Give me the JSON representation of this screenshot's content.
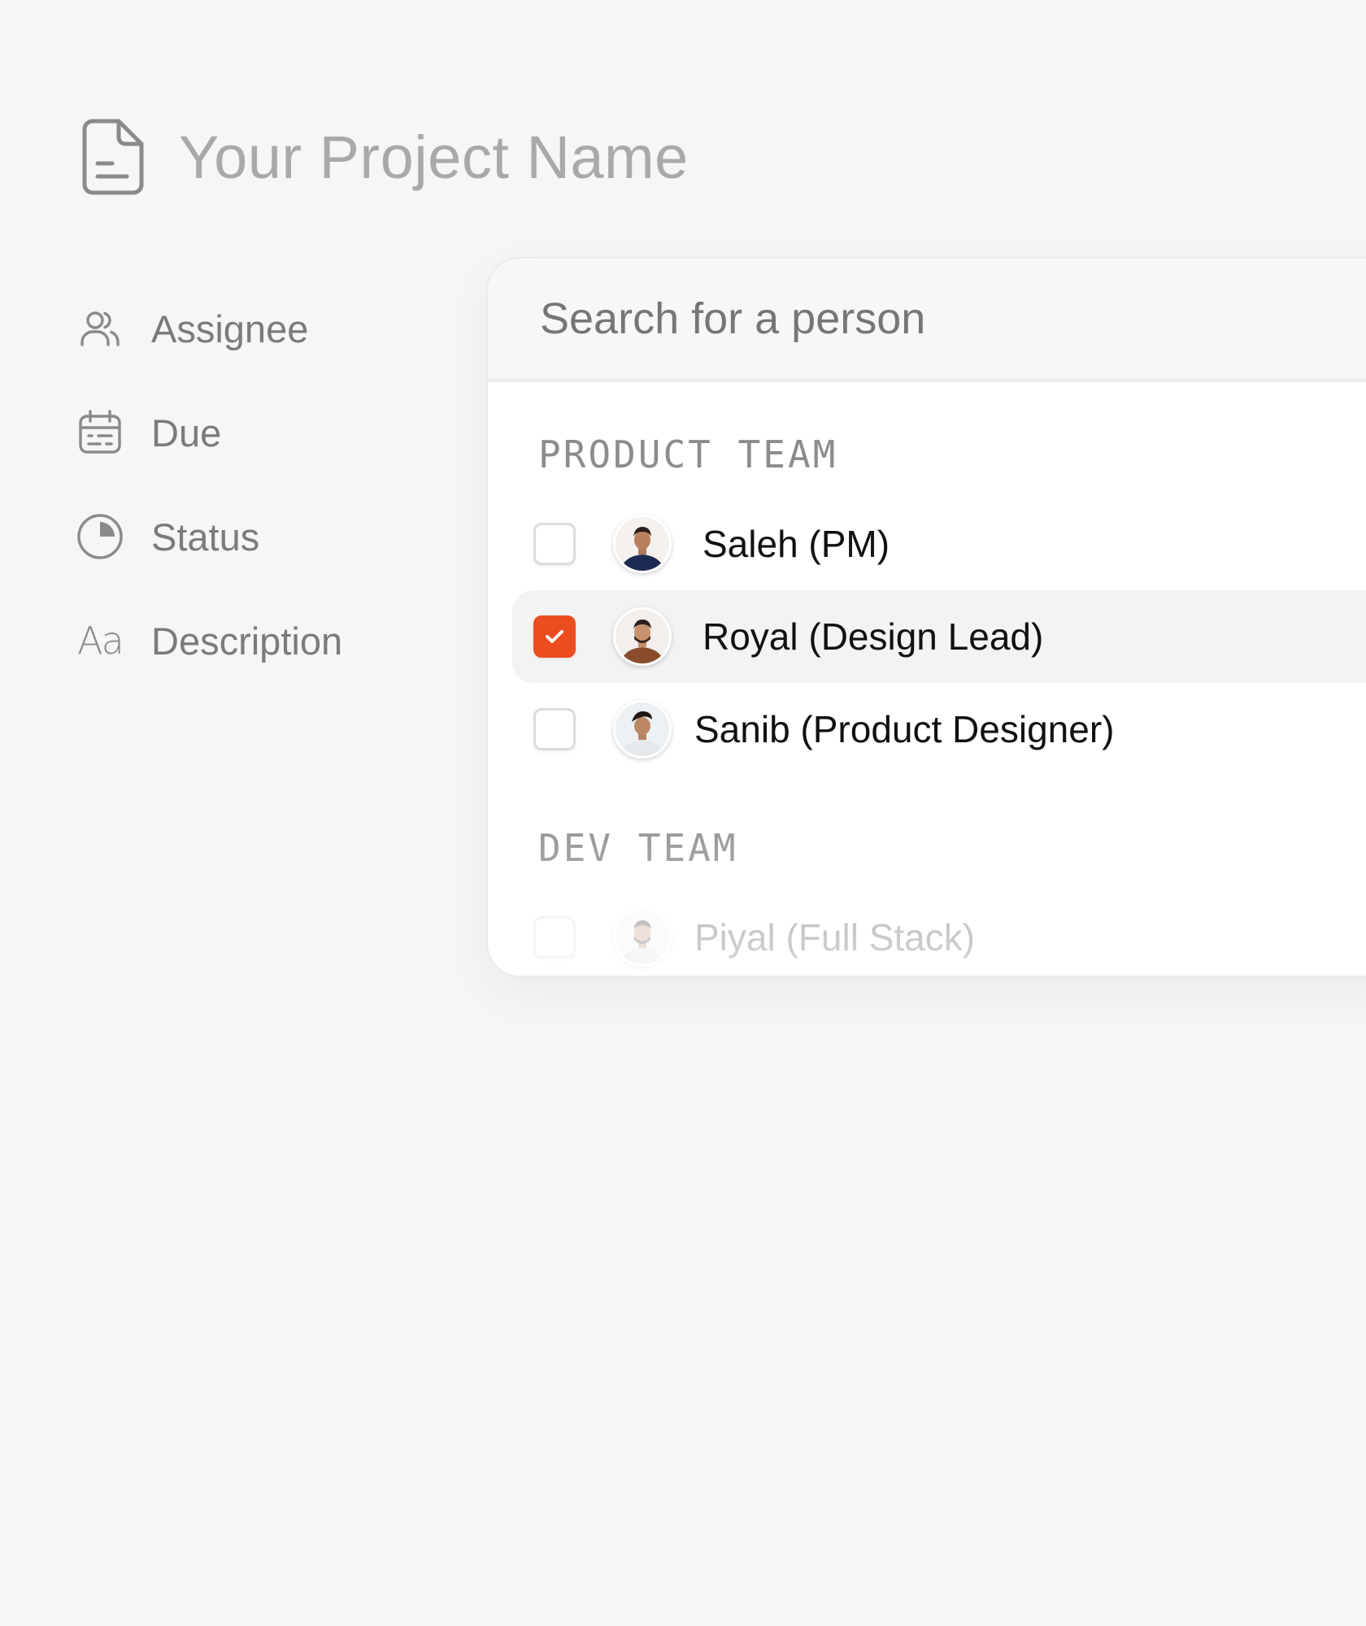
{
  "project": {
    "name": "Your Project Name",
    "icon": "document-icon"
  },
  "properties": [
    {
      "label": "Assignee",
      "icon": "users-icon"
    },
    {
      "label": "Due",
      "icon": "calendar-icon"
    },
    {
      "label": "Status",
      "icon": "pie-status-icon"
    },
    {
      "label": "Description",
      "icon": "text-aa-icon",
      "glyph": "Aa"
    }
  ],
  "picker": {
    "search_placeholder": "Search for a person",
    "groups": [
      {
        "title": "PRODUCT TEAM",
        "people": [
          {
            "name": "Saleh (PM)",
            "checked": false
          },
          {
            "name": "Royal (Design Lead)",
            "checked": true
          },
          {
            "name": "Sanib (Product Designer)",
            "checked": false
          }
        ]
      },
      {
        "title": "DEV TEAM",
        "people": [
          {
            "name": "Piyal  (Full Stack)",
            "checked": false
          }
        ]
      }
    ]
  },
  "colors": {
    "background": "#f6f6f6",
    "accent_checked": "#ec4d1f",
    "title_gray": "#a9a9a9"
  }
}
